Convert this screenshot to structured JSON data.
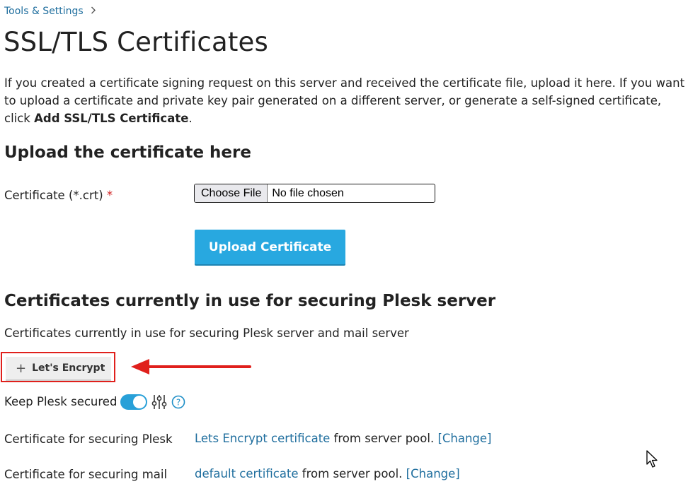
{
  "breadcrumb": {
    "items": [
      "Tools & Settings"
    ]
  },
  "page_title": "SSL/TLS Certificates",
  "intro": {
    "text": "If you created a certificate signing request on this server and received the certificate file, upload it here. If you want to upload a certificate and private key pair generated on a different server, or generate a self-signed certificate, click ",
    "bold": "Add SSL/TLS Certificate",
    "end": "."
  },
  "upload_section": {
    "heading": "Upload the certificate here",
    "certificate_label": "Certificate (*.crt)",
    "required_mark": "*",
    "file_button": "Choose File",
    "file_status": "No file chosen",
    "upload_button": "Upload Certificate"
  },
  "current_section": {
    "heading": "Certificates currently in use for securing Plesk server",
    "subtext": "Certificates currently in use for securing Plesk server and mail server",
    "lets_encrypt_button": "Let's Encrypt",
    "keep_secured_label": "Keep Plesk secured",
    "keep_secured_enabled": true,
    "plesk_cert_label": "Certificate for securing Plesk",
    "plesk_cert_link": "Lets Encrypt certificate",
    "plesk_cert_suffix": " from server pool. ",
    "plesk_change": "[Change]",
    "mail_cert_label": "Certificate for securing mail",
    "mail_cert_link": "default certificate",
    "mail_cert_suffix": " from server pool. ",
    "mail_change": "[Change]"
  },
  "colors": {
    "link": "#1f6e9e",
    "primary_button": "#28a8e0",
    "toggle_on": "#28a0d8",
    "annotation_red": "#e0201c"
  }
}
